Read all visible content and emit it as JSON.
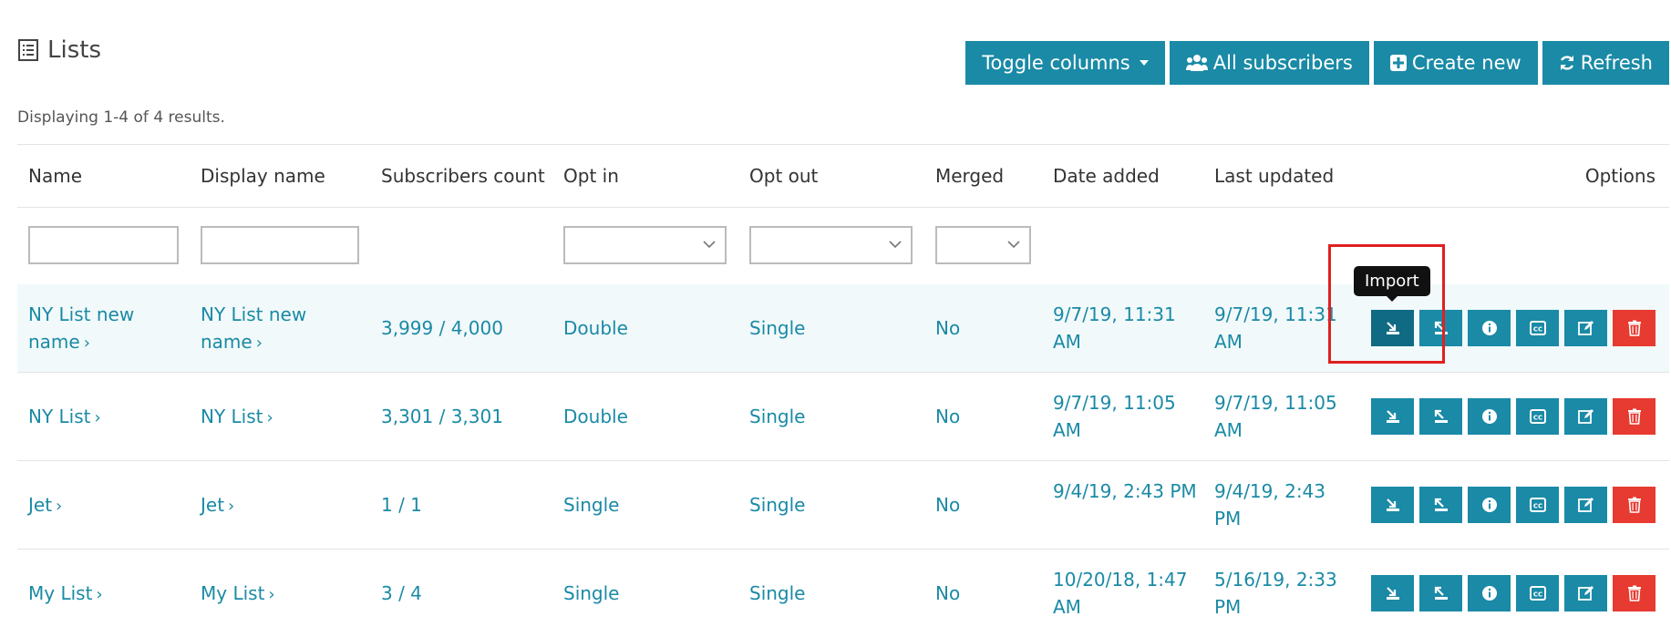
{
  "header": {
    "title": "Lists",
    "icon": "list-icon"
  },
  "toolbar": {
    "toggle_columns": "Toggle columns",
    "all_subscribers": "All subscribers",
    "create_new": "Create new",
    "refresh": "Refresh"
  },
  "summary": "Displaying 1-4 of 4 results.",
  "columns": [
    "Name",
    "Display name",
    "Subscribers count",
    "Opt in",
    "Opt out",
    "Merged",
    "Date added",
    "Last updated",
    "Options"
  ],
  "rows": [
    {
      "name": "NY List new name",
      "display_name": "NY List new name",
      "subscribers": "3,999 / 4,000",
      "opt_in": "Double",
      "opt_out": "Single",
      "merged": "No",
      "date_added": "9/7/19, 11:31 AM",
      "last_updated": "9/7/19, 11:31 AM"
    },
    {
      "name": "NY List",
      "display_name": "NY List",
      "subscribers": "3,301 / 3,301",
      "opt_in": "Double",
      "opt_out": "Single",
      "merged": "No",
      "date_added": "9/7/19, 11:05 AM",
      "last_updated": "9/7/19, 11:05 AM"
    },
    {
      "name": "Jet",
      "display_name": "Jet",
      "subscribers": "1 / 1",
      "opt_in": "Single",
      "opt_out": "Single",
      "merged": "No",
      "date_added": "9/4/19, 2:43 PM",
      "last_updated": "9/4/19, 2:43 PM"
    },
    {
      "name": "My List",
      "display_name": "My List",
      "subscribers": "3 / 4",
      "opt_in": "Single",
      "opt_out": "Single",
      "merged": "No",
      "date_added": "10/20/18, 1:47 AM",
      "last_updated": "5/16/19, 2:33 PM"
    }
  ],
  "tooltip": "Import",
  "colors": {
    "primary": "#1a8aa6",
    "danger": "#e73a30",
    "link": "#1a8aa6"
  },
  "option_icons": [
    "import-icon",
    "export-icon",
    "info-icon",
    "cc-icon",
    "edit-icon",
    "trash-icon"
  ]
}
